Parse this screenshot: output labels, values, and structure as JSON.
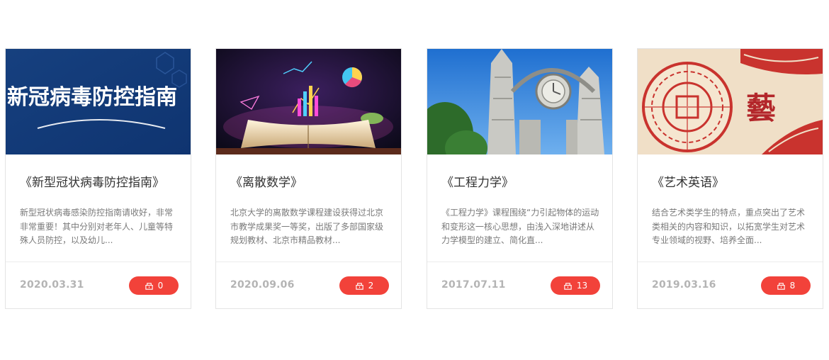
{
  "cards": [
    {
      "title": "《新型冠状病毒防控指南》",
      "description": "新型冠状病毒感染防控指南请收好，非常非常重要！其中分别对老年人、儿童等特殊人员防控，以及幼儿...",
      "date": "2020.03.31",
      "count": "0",
      "cover_text": "新冠病毒防控指南",
      "icon": "book-stack-icon"
    },
    {
      "title": "《离散数学》",
      "description": "北京大学的离散数学课程建设获得过北京市教学成果奖一等奖，出版了多部国家级规划教材、北京市精品教材...",
      "date": "2020.09.06",
      "count": "2",
      "icon": "book-stack-icon"
    },
    {
      "title": "《工程力学》",
      "description": "《工程力学》课程围绕“力引起物体的运动和变形这一核心思想，由浅入深地讲述从力学模型的建立、简化直...",
      "date": "2017.07.11",
      "count": "13",
      "icon": "book-stack-icon"
    },
    {
      "title": "《艺术英语》",
      "description": "结合艺术类学生的特点，重点突出了艺术类相关的内容和知识，以拓宽学生对艺术专业领域的视野、培养全面...",
      "date": "2019.03.16",
      "count": "8",
      "cover_text": "藝",
      "icon": "book-stack-icon"
    }
  ],
  "colors": {
    "badge": "#f2423a",
    "date": "#b4b4b4",
    "title": "#333333",
    "description": "#7a7a7a"
  }
}
